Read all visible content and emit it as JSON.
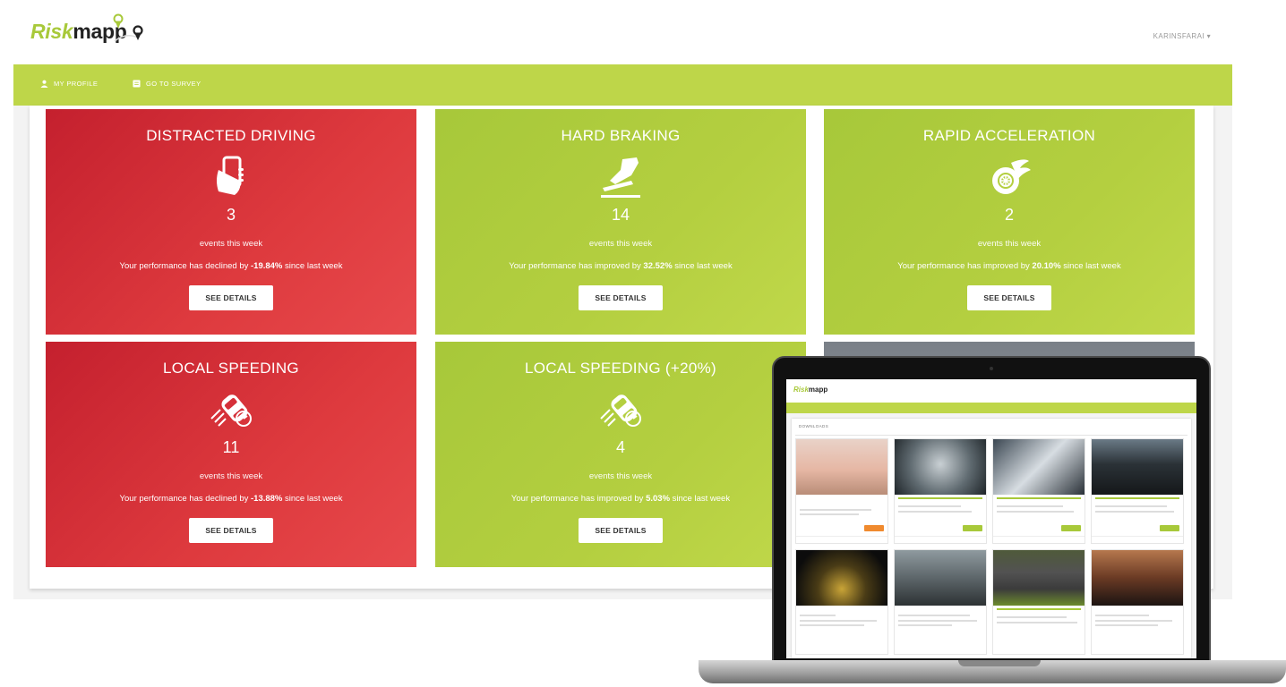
{
  "header": {
    "logo_risk": "Risk",
    "logo_mapp": "mapp",
    "user": "KARINSFARAI ▾"
  },
  "nav": {
    "items": [
      {
        "label": "MY PROFILE",
        "icon": "user-icon"
      },
      {
        "label": "GO TO SURVEY",
        "icon": "clipboard-icon"
      }
    ]
  },
  "cards": [
    {
      "title": "DISTRACTED DRIVING",
      "icon": "phone-in-hand-icon",
      "count": "3",
      "unit": "events this week",
      "perf_prefix": "Your performance has declined by ",
      "perf_value": "-19.84%",
      "perf_suffix": " since last week",
      "button": "SEE DETAILS",
      "status": "declined",
      "color": "#d5303a"
    },
    {
      "title": "HARD BRAKING",
      "icon": "foot-on-pedal-icon",
      "count": "14",
      "unit": "events this week",
      "perf_prefix": "Your performance has improved by ",
      "perf_value": "32.52%",
      "perf_suffix": " since last week",
      "button": "SEE DETAILS",
      "status": "improved",
      "color": "#b4cf40"
    },
    {
      "title": "RAPID ACCELERATION",
      "icon": "flaming-wheel-icon",
      "count": "2",
      "unit": "events this week",
      "perf_prefix": "Your performance has improved by ",
      "perf_value": "20.10%",
      "perf_suffix": " since last week",
      "button": "SEE DETAILS",
      "status": "improved",
      "color": "#b4cf40"
    },
    {
      "title": "LOCAL SPEEDING",
      "icon": "speeding-car-icon",
      "count": "11",
      "unit": "events this week",
      "perf_prefix": "Your performance has declined by ",
      "perf_value": "-13.88%",
      "perf_suffix": " since last week",
      "button": "SEE DETAILS",
      "status": "declined",
      "color": "#d5303a"
    },
    {
      "title": "LOCAL SPEEDING (+20%)",
      "icon": "speeding-car-icon",
      "count": "4",
      "unit": "events this week",
      "perf_prefix": "Your performance has improved by ",
      "perf_value": "5.03%",
      "perf_suffix": " since last week",
      "button": "SEE DETAILS",
      "status": "improved",
      "color": "#b4cf40"
    }
  ],
  "laptop_screen": {
    "logo_risk": "Risk",
    "logo_mapp": "mapp",
    "section": "DOWNLOADS",
    "tiles": 8
  }
}
